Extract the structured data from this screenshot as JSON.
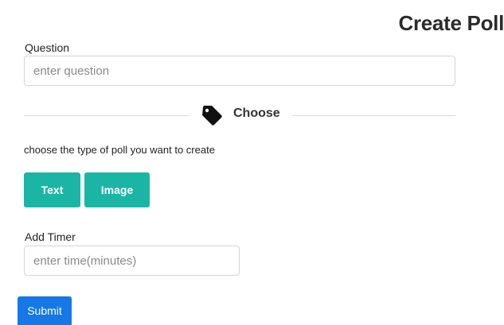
{
  "header": {
    "title": "Create Poll"
  },
  "question": {
    "label": "Question",
    "placeholder": "enter question",
    "value": ""
  },
  "divider": {
    "icon": "tag-icon",
    "label": "Choose"
  },
  "poll_type": {
    "helper": "choose the type of poll you want to create",
    "options": [
      {
        "label": "Text"
      },
      {
        "label": "Image"
      }
    ]
  },
  "timer": {
    "label": "Add Timer",
    "placeholder": "enter time(minutes)",
    "value": ""
  },
  "actions": {
    "submit_label": "Submit"
  },
  "colors": {
    "accent_teal": "#1bb5a5",
    "submit_blue": "#1677e6",
    "divider_gray": "#d9d9d9"
  }
}
